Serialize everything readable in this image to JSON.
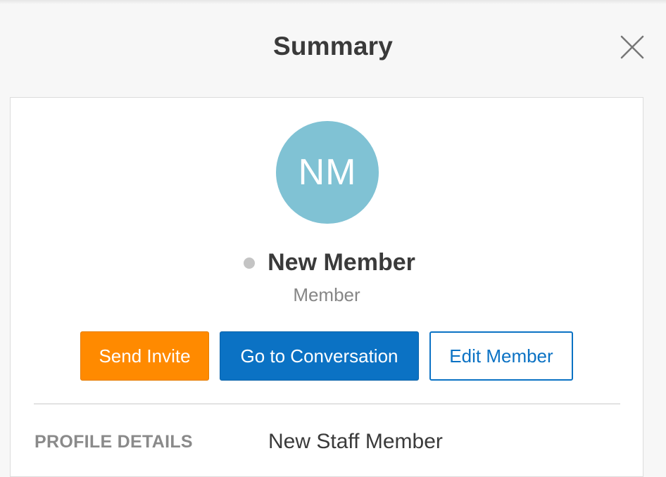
{
  "header": {
    "title": "Summary",
    "close_icon": "close-icon"
  },
  "member": {
    "initials": "NM",
    "avatar_color": "#80c2d4",
    "status_color": "#c4c4c4",
    "name": "New Member",
    "role": "Member"
  },
  "actions": {
    "send_invite_label": "Send Invite",
    "send_invite_color": "#ff8a00",
    "conversation_label": "Go to Conversation",
    "conversation_color": "#0b72c4",
    "edit_label": "Edit Member"
  },
  "profile": {
    "section_label": "PROFILE DETAILS",
    "value": "New Staff Member"
  }
}
